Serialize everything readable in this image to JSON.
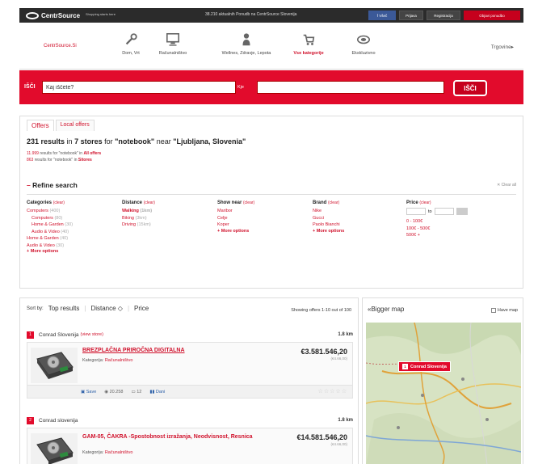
{
  "topbar": {
    "logo_text": "CentrSource",
    "slogan": "Shopping starts here",
    "center_text": "38.210 aktualnih Ponudb na CentrSource Slovenija",
    "buttons": [
      "f Všeč",
      "Prijava",
      "Registracija",
      "Objavi ponudbo"
    ]
  },
  "catnav": {
    "site_link": "CentrSource.Si",
    "categories": [
      {
        "label": "Dom, Vrt",
        "icon": "tools-icon"
      },
      {
        "label": "Računalništvo",
        "icon": "monitor-icon"
      },
      {
        "label": "Wellnes, Zdravje, Lepota",
        "icon": "person-icon"
      },
      {
        "label": "Vse kategorije",
        "icon": "shopping-cart-icon"
      },
      {
        "label": "Ekskluzivno",
        "icon": "target-icon"
      }
    ],
    "trgovine": "Trgovine▸"
  },
  "search": {
    "what_label": "IŠČI",
    "what_value": "Kaj iščete?",
    "where_label": "Kje",
    "where_value": "",
    "button": "IŠČI"
  },
  "results": {
    "tabs": [
      "Offers",
      "Local offers"
    ],
    "summary_count": "231 results",
    "summary_in": "in",
    "summary_stores": "7 stores",
    "summary_for": "for",
    "summary_query": "\"notebook\"",
    "summary_near": "near",
    "summary_location": "\"Ljubljana, Slovenia\"",
    "sub1_count": "11.999",
    "sub1_text": "results for \"notebook\" in",
    "sub1_link": "All offers",
    "sub2_count": "863",
    "sub2_text": "results for \"notebook\" in",
    "sub2_link": "Sitores"
  },
  "refine": {
    "title": "Refine search",
    "clear_all": "Clear all",
    "facets": {
      "categories": {
        "title": "Categories",
        "clear": "(clear)",
        "items": [
          {
            "label": "Computers",
            "count": "(400)",
            "bold": false,
            "indent": false
          },
          {
            "label": "Computers",
            "count": "(80)",
            "bold": false,
            "indent": true
          },
          {
            "label": "Home & Garden",
            "count": "(30)",
            "bold": false,
            "indent": true
          },
          {
            "label": "Audio & Video",
            "count": "(40)",
            "bold": false,
            "indent": true
          },
          {
            "label": "Home & Garden",
            "count": "(40)",
            "bold": false,
            "indent": false
          },
          {
            "label": "Audio & Video",
            "count": "(30)",
            "bold": false,
            "indent": false
          }
        ],
        "more": "+ More options"
      },
      "distance": {
        "title": "Distance",
        "clear": "(clear)",
        "items": [
          {
            "label": "Walking",
            "count": "(1km)",
            "bold": true
          },
          {
            "label": "Biking",
            "count": "(3km)",
            "bold": false
          },
          {
            "label": "Driving",
            "count": "(15km)",
            "bold": false
          }
        ]
      },
      "shownear": {
        "title": "Show near",
        "clear": "(clear)",
        "items": [
          {
            "label": "Maribor",
            "count": ""
          },
          {
            "label": "Celje",
            "count": ""
          },
          {
            "label": "Koper",
            "count": ""
          }
        ],
        "more": "+ More options"
      },
      "brand": {
        "title": "Brand",
        "clear": "(clear)",
        "items": [
          {
            "label": "Nike",
            "count": ""
          },
          {
            "label": "Gucci",
            "count": ""
          },
          {
            "label": "Paolo Bianchi",
            "count": ""
          }
        ],
        "more": "+ More options"
      },
      "price": {
        "title": "Price",
        "clear": "(clear)",
        "to": "to",
        "items": [
          {
            "label": "0 - 100€"
          },
          {
            "label": "100€ - 500€"
          },
          {
            "label": "500€ +"
          }
        ]
      }
    }
  },
  "offers": {
    "sort_label": "Sort by:",
    "sort_options": [
      "Top results",
      "Distance ◇",
      "Price"
    ],
    "showing": "Showing offers 1-10 out of 100",
    "items": [
      {
        "num": "1",
        "store": "Conrad Slovenija",
        "store_link": "(view store)",
        "distance": "1.8 km",
        "title": "BREZPLAČNA PRIROČNA DIGITALNA",
        "category_label": "Kategorija:",
        "category": "Računalništvo",
        "price": "€3.581.546,20",
        "old_price": "(€4.66,00)",
        "save": "Save",
        "views": "20.258",
        "comments": "12",
        "rate": "Dani",
        "stars": "☆☆☆☆☆"
      },
      {
        "num": "2",
        "store": "Conrad slovenija",
        "store_link": "",
        "distance": "1.8 km",
        "title": "GAM-05, ČAKRA -Spostobnost izražanja, Neodvisnost, Resnica",
        "category_label": "Kategorija:",
        "category": "Računalništvo",
        "price": "€14.581.546,20",
        "old_price": "(€4.66,00)"
      }
    ]
  },
  "map": {
    "title": "«Bigger map",
    "have_map": "Have map",
    "pin_num": "1",
    "pin_label": "Conrad Slovenija"
  },
  "colors": {
    "brand_red": "#e20b2c",
    "top_dark": "#2b2b2b",
    "map_land": "#d7e3c3"
  }
}
